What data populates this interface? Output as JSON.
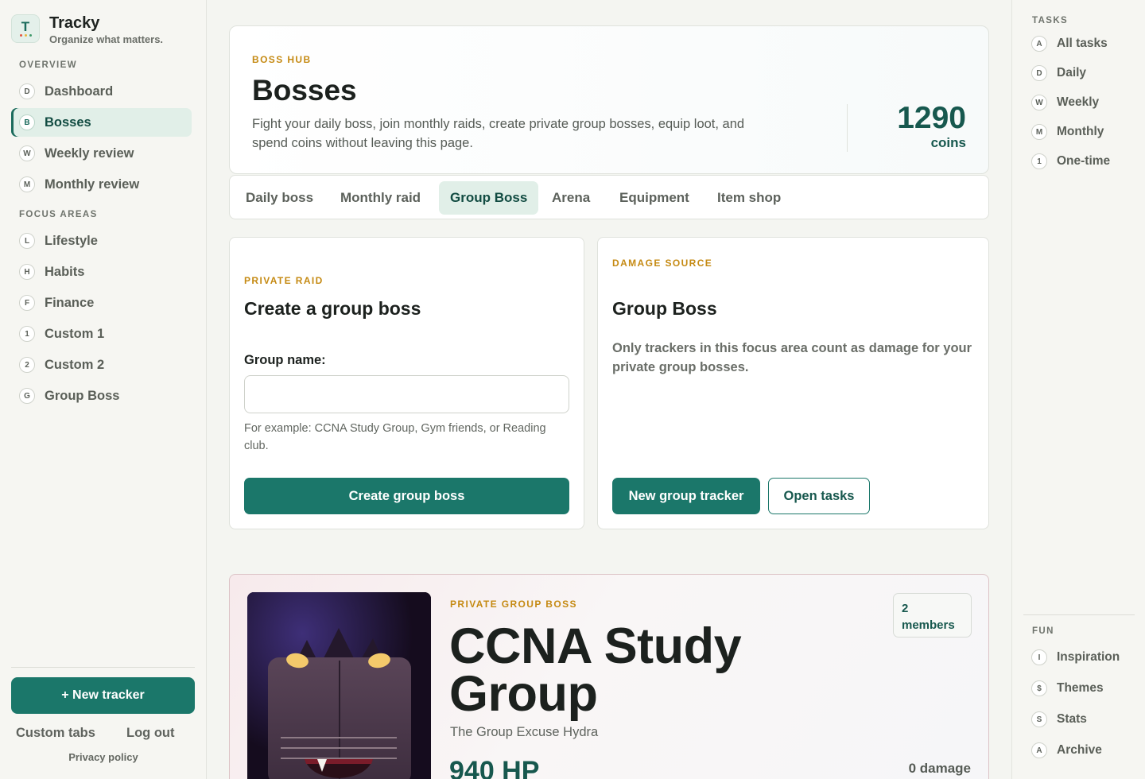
{
  "brand": {
    "logo_letter": "T",
    "name": "Tracky",
    "tagline": "Organize what matters.",
    "dot_colors": [
      "#e2533f",
      "#e7b43a",
      "#3f9a6b"
    ]
  },
  "sidebar": {
    "overview_title": "OVERVIEW",
    "overview_items": [
      {
        "key": "D",
        "label": "Dashboard"
      },
      {
        "key": "B",
        "label": "Bosses",
        "active": true
      },
      {
        "key": "W",
        "label": "Weekly review"
      },
      {
        "key": "M",
        "label": "Monthly review"
      }
    ],
    "focus_title": "FOCUS AREAS",
    "focus_items": [
      {
        "key": "L",
        "label": "Lifestyle"
      },
      {
        "key": "H",
        "label": "Habits"
      },
      {
        "key": "F",
        "label": "Finance"
      },
      {
        "key": "1",
        "label": "Custom 1"
      },
      {
        "key": "2",
        "label": "Custom 2"
      },
      {
        "key": "G",
        "label": "Group Boss"
      }
    ],
    "new_tracker_label": "+ New tracker",
    "custom_tabs_label": "Custom tabs",
    "logout_label": "Log out",
    "privacy_label": "Privacy policy"
  },
  "right_sidebar": {
    "tasks_title": "TASKS",
    "tasks": [
      {
        "key": "A",
        "label": "All tasks"
      },
      {
        "key": "D",
        "label": "Daily"
      },
      {
        "key": "W",
        "label": "Weekly"
      },
      {
        "key": "M",
        "label": "Monthly"
      },
      {
        "key": "1",
        "label": "One-time"
      }
    ],
    "fun_title": "FUN",
    "fun": [
      {
        "key": "I",
        "label": "Inspiration"
      },
      {
        "key": "$",
        "label": "Themes"
      },
      {
        "key": "S",
        "label": "Stats"
      },
      {
        "key": "A",
        "label": "Archive"
      }
    ]
  },
  "hero": {
    "eyebrow": "BOSS HUB",
    "title": "Bosses",
    "description": "Fight your daily boss, join monthly raids, create private group bosses, equip loot, and spend coins without leaving this page.",
    "coins_value": "1290",
    "coins_label": "coins"
  },
  "tabs": [
    {
      "label": "Daily boss"
    },
    {
      "label": "Monthly raid"
    },
    {
      "label": "Group Boss",
      "active": true
    },
    {
      "label": "Arena"
    },
    {
      "label": "Equipment"
    },
    {
      "label": "Item shop"
    }
  ],
  "create_card": {
    "eyebrow": "PRIVATE RAID",
    "title": "Create a group boss",
    "field_label": "Group name:",
    "field_value": "",
    "hint": "For example: CCNA Study Group, Gym friends, or Reading club.",
    "button_label": "Create group boss"
  },
  "damage_card": {
    "eyebrow": "DAMAGE SOURCE",
    "title": "Group Boss",
    "description": "Only trackers in this focus area count as damage for your private group bosses.",
    "primary_button": "New group tracker",
    "secondary_button": "Open tasks"
  },
  "boss": {
    "eyebrow": "PRIVATE GROUP BOSS",
    "name": "CCNA Study Group",
    "subtitle": "The Group Excuse Hydra",
    "hp": "940 HP",
    "members": "2 members",
    "damage": "0 damage"
  },
  "colors": {
    "accent": "#1b776a",
    "accent_dark": "#17584e",
    "eyebrow": "#c58a13",
    "active_bg": "#e1efe8"
  }
}
